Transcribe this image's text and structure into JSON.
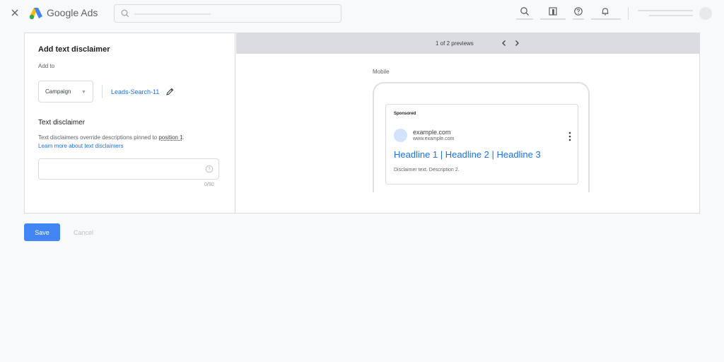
{
  "app": {
    "brand": "Google Ads"
  },
  "icons": {
    "close": "close-icon",
    "logo": "google-ads-logo",
    "search": "search-icon",
    "reports": "reports-icon",
    "help": "help-icon",
    "notifications": "bell-icon",
    "edit": "pencil-icon",
    "prev": "chevron-left-icon",
    "next": "chevron-right-icon",
    "more": "more-vert-icon"
  },
  "colors": {
    "accent": "#1a73e8",
    "primary_button": "#4285f4"
  },
  "form": {
    "title": "Add text disclaimer",
    "add_to_label": "Add to",
    "level_select": "Campaign",
    "campaign_name": "Leads-Search-11",
    "section_title": "Text disclaimer",
    "description_prefix": "Text disclaimers override descriptions pinned to ",
    "description_link": "position 1",
    "description_suffix": ".",
    "learn_more": "Learn more about text disclaimers",
    "input_value": "",
    "char_counter": "0/90"
  },
  "preview": {
    "count_text": "1 of 2 previews",
    "device_label": "Mobile",
    "sponsored": "Sponsored",
    "domain": "example.com",
    "url": "www.example.com",
    "headline": "Headline 1 | Headline 2 | Headline 3",
    "description": "Disclaimer text. Description 2."
  },
  "actions": {
    "save": "Save",
    "cancel": "Cancel"
  }
}
